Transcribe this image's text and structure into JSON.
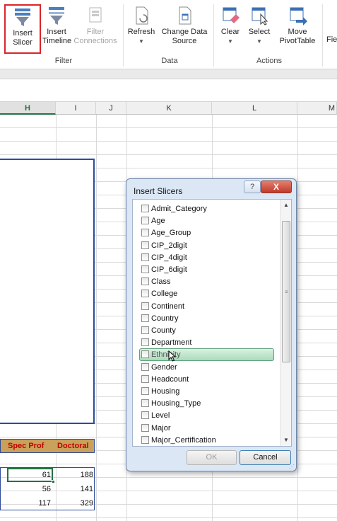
{
  "ribbon": {
    "insert_slicer": "Insert Slicer",
    "insert_timeline": "Insert Timeline",
    "filter_connections": "Filter Connections",
    "refresh": "Refresh",
    "change_data_source": "Change Data Source",
    "clear": "Clear",
    "select": "Select",
    "move_pivottable": "Move PivotTable",
    "fields_cut": "Fiel &",
    "groups": {
      "filter": "Filter",
      "data": "Data",
      "actions": "Actions"
    }
  },
  "columns": [
    "H",
    "I",
    "J",
    "K",
    "L",
    "M"
  ],
  "pivot": {
    "headers": [
      "Spec Prof",
      "Doctoral"
    ],
    "rows": [
      [
        "61",
        "188"
      ],
      [
        "56",
        "141"
      ],
      [
        "117",
        "329"
      ]
    ]
  },
  "dialog": {
    "title": "Insert Slicers",
    "help": "?",
    "close": "X",
    "fields": [
      "Admit_Category",
      "Age",
      "Age_Group",
      "CIP_2digit",
      "CIP_4digit",
      "CIP_6digit",
      "Class",
      "College",
      "Continent",
      "Country",
      "County",
      "Department",
      "Ethnicity",
      "Gender",
      "Headcount",
      "Housing",
      "Housing_Type",
      "Level",
      "Major",
      "Major_Certification"
    ],
    "hovered": "Ethnicity",
    "ok": "OK",
    "cancel": "Cancel"
  },
  "colors": {
    "excel_green": "#217346",
    "close_red": "#c0392b",
    "pivot_border": "#2e4b9b",
    "highlight_red": "#d9252a"
  }
}
